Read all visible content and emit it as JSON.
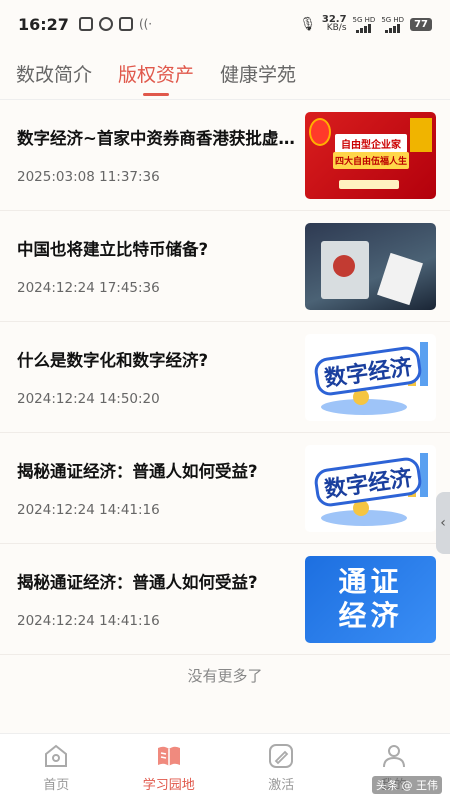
{
  "status": {
    "time": "16:27",
    "net_speed_value": "32.7",
    "net_speed_unit": "KB/s",
    "sim1_label": "5G HD",
    "sim2_label": "5G HD",
    "battery": "77"
  },
  "tabs": [
    {
      "label": "数改简介",
      "active": false
    },
    {
      "label": "版权资产",
      "active": true
    },
    {
      "label": "健康学苑",
      "active": false
    }
  ],
  "articles": [
    {
      "title": "数字经济~首家中资券商香港获批虚拟…",
      "date": "2025:03:08 11:37:36",
      "thumb": {
        "style": "red-ad",
        "line1": "自由型企业家",
        "line2": "四大自由伍福人生"
      }
    },
    {
      "title": "中国也将建立比特币储备?",
      "date": "2024:12:24 17:45:36",
      "thumb": {
        "style": "dark-machine"
      }
    },
    {
      "title": "什么是数字化和数字经济?",
      "date": "2024:12:24 14:50:20",
      "thumb": {
        "style": "3d-text",
        "text": "数字经济"
      }
    },
    {
      "title": "揭秘通证经济：普通人如何受益?",
      "date": "2024:12:24 14:41:16",
      "thumb": {
        "style": "3d-text",
        "text": "数字经济"
      }
    },
    {
      "title": "揭秘通证经济：普通人如何受益?",
      "date": "2024:12:24 14:41:16",
      "thumb": {
        "style": "blue-text",
        "line1": "通证",
        "line2": "经济"
      }
    }
  ],
  "no_more_text": "没有更多了",
  "bottom_nav": [
    {
      "label": "首页",
      "icon": "home-icon",
      "active": false
    },
    {
      "label": "学习园地",
      "icon": "book-icon",
      "active": true
    },
    {
      "label": "激活",
      "icon": "pen-icon",
      "active": false
    },
    {
      "label": "我的",
      "icon": "user-icon",
      "active": false
    }
  ],
  "watermark": "头条 @ 王伟",
  "accent_color": "#e0584b"
}
